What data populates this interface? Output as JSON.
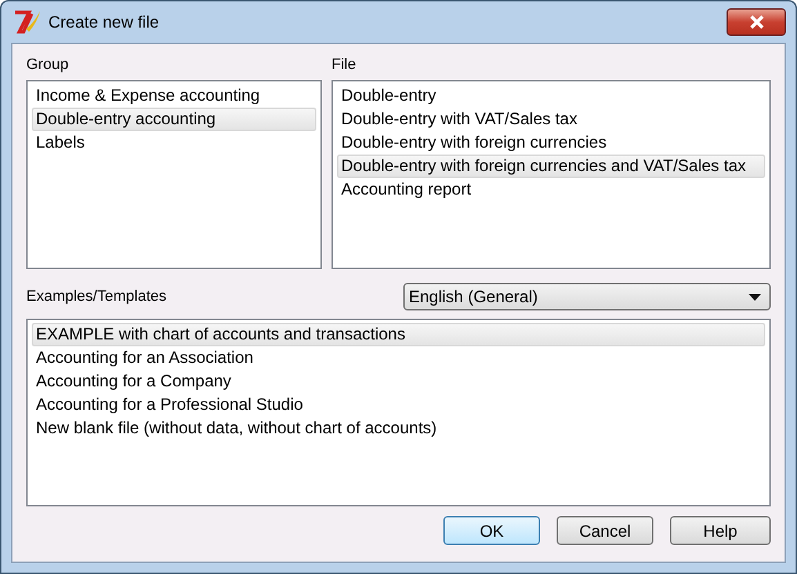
{
  "window": {
    "title": "Create new file"
  },
  "group": {
    "label": "Group",
    "items": [
      {
        "label": "Income & Expense accounting",
        "selected": false
      },
      {
        "label": "Double-entry accounting",
        "selected": true
      },
      {
        "label": "Labels",
        "selected": false
      }
    ]
  },
  "file": {
    "label": "File",
    "items": [
      {
        "label": "Double-entry",
        "selected": false
      },
      {
        "label": "Double-entry with VAT/Sales tax",
        "selected": false
      },
      {
        "label": "Double-entry with foreign currencies",
        "selected": false
      },
      {
        "label": "Double-entry with foreign currencies and VAT/Sales tax",
        "selected": true
      },
      {
        "label": "Accounting report",
        "selected": false
      }
    ]
  },
  "templates": {
    "label": "Examples/Templates",
    "language": "English (General)",
    "items": [
      {
        "label": "EXAMPLE with chart of accounts and transactions",
        "selected": true
      },
      {
        "label": "Accounting for an Association",
        "selected": false
      },
      {
        "label": "Accounting for a Company",
        "selected": false
      },
      {
        "label": "Accounting for a Professional Studio",
        "selected": false
      },
      {
        "label": "New blank file (without data, without chart of accounts)",
        "selected": false
      }
    ]
  },
  "buttons": [
    {
      "label": "OK",
      "default": true
    },
    {
      "label": "Cancel",
      "default": false
    },
    {
      "label": "Help",
      "default": false
    }
  ]
}
